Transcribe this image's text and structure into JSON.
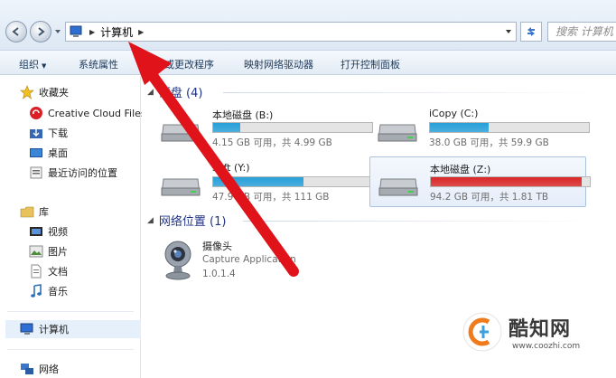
{
  "address_bar": {
    "breadcrumb": "计算机",
    "search_placeholder": "搜索 计算机"
  },
  "toolbar": {
    "organize": "组织",
    "system_properties": "系统属性",
    "uninstall": "卸载或更改程序",
    "map_drive": "映射网络驱动器",
    "control_panel": "打开控制面板"
  },
  "sidebar": {
    "favorites": "收藏夹",
    "creative_cloud": "Creative Cloud Files",
    "downloads": "下载",
    "desktop": "桌面",
    "recent": "最近访问的位置",
    "libraries": "库",
    "videos": "视频",
    "pictures": "图片",
    "documents": "文档",
    "music": "音乐",
    "computer": "计算机",
    "network": "网络"
  },
  "hard_drives": {
    "header": "硬盘 (4)",
    "drives": [
      {
        "name": "本地磁盘 (B:)",
        "info": "4.15 GB 可用，共 4.99 GB",
        "used_fraction": 0.17,
        "bar_color": "#26a0da"
      },
      {
        "name": "iCopy (C:)",
        "info": "38.0 GB 可用，共 59.9 GB",
        "used_fraction": 0.37,
        "bar_color": "#26a0da"
      },
      {
        "name": "soft (Y:)",
        "info": "47.9 GB 可用，共 111 GB",
        "used_fraction": 0.57,
        "bar_color": "#26a0da"
      },
      {
        "name": "本地磁盘 (Z:)",
        "info": "94.2 GB 可用，共 1.81 TB",
        "used_fraction": 0.95,
        "bar_color": "#da2626"
      }
    ]
  },
  "network_locations": {
    "header": "网络位置 (1)",
    "item": {
      "name": "摄像头",
      "subtitle": "Capture Application",
      "version": "1.0.1.4"
    }
  },
  "watermark": {
    "brand": "酷知网",
    "url": "www.coozhi.com"
  },
  "colors": {
    "accent": "#1e3287",
    "arrow": "#e0131b",
    "bar_normal": "#26a0da",
    "bar_full": "#da2626"
  }
}
